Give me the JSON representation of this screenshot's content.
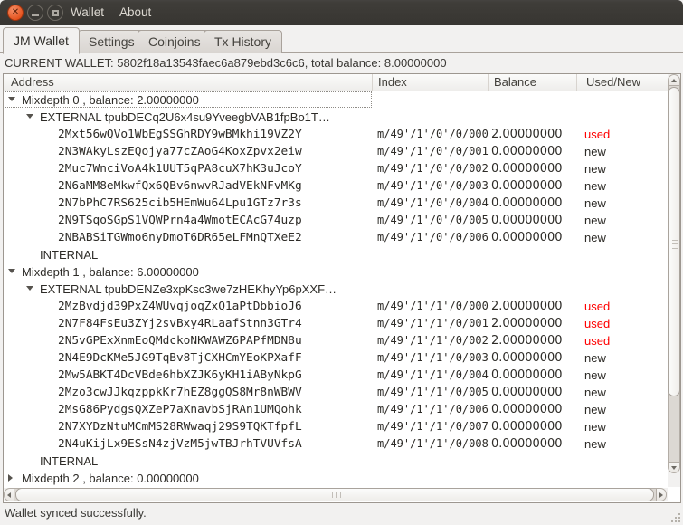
{
  "titlebar": {
    "menus": [
      "Wallet",
      "About"
    ]
  },
  "tabs": [
    {
      "label": "JM Wallet",
      "active": true
    },
    {
      "label": "Settings",
      "active": false
    },
    {
      "label": "Coinjoins",
      "active": false
    },
    {
      "label": "Tx History",
      "active": false
    }
  ],
  "wallet_summary": "CURRENT WALLET: 5802f18a13543faec6a879ebd3c6c6, total balance: 8.00000000",
  "tree": {
    "columns": [
      "Address",
      "Index",
      "Balance",
      "Used/New"
    ],
    "rows": [
      {
        "type": "group",
        "level": 0,
        "expanded": true,
        "focused": true,
        "label": "Mixdepth 0 , balance: 2.00000000"
      },
      {
        "type": "group",
        "level": 1,
        "expanded": true,
        "label": "EXTERNAL tpubDECq2U6x4su9YveegbVAB1fpBo1T…"
      },
      {
        "type": "address",
        "level": 2,
        "address": "2Mxt56wQVo1WbEgSSGhRDY9wBMkhi19VZ2Y",
        "index": "m/49'/1'/0'/0/000",
        "balance": "2.00000000",
        "status": "used"
      },
      {
        "type": "address",
        "level": 2,
        "address": "2N3WAkyLszEQojya77cZAoG4KoxZpvx2eiw",
        "index": "m/49'/1'/0'/0/001",
        "balance": "0.00000000",
        "status": "new"
      },
      {
        "type": "address",
        "level": 2,
        "address": "2Muc7WnciVoA4k1UUT5qPA8cuX7hK3uJcoY",
        "index": "m/49'/1'/0'/0/002",
        "balance": "0.00000000",
        "status": "new"
      },
      {
        "type": "address",
        "level": 2,
        "address": "2N6aMM8eMkwfQx6QBv6nwvRJadVEkNFvMKg",
        "index": "m/49'/1'/0'/0/003",
        "balance": "0.00000000",
        "status": "new"
      },
      {
        "type": "address",
        "level": 2,
        "address": "2N7bPhC7RS625cib5HEmWu64Lpu1GTz7r3s",
        "index": "m/49'/1'/0'/0/004",
        "balance": "0.00000000",
        "status": "new"
      },
      {
        "type": "address",
        "level": 2,
        "address": "2N9TSqoSGpS1VQWPrn4a4WmotECAcG74uzp",
        "index": "m/49'/1'/0'/0/005",
        "balance": "0.00000000",
        "status": "new"
      },
      {
        "type": "address",
        "level": 2,
        "address": "2NBABSiTGWmo6nyDmoT6DR65eLFMnQTXeE2",
        "index": "m/49'/1'/0'/0/006",
        "balance": "0.00000000",
        "status": "new"
      },
      {
        "type": "group",
        "level": 1,
        "label": "INTERNAL"
      },
      {
        "type": "group",
        "level": 0,
        "expanded": true,
        "label": "Mixdepth 1 , balance: 6.00000000"
      },
      {
        "type": "group",
        "level": 1,
        "expanded": true,
        "label": "EXTERNAL tpubDENZe3xpKsc3we7zHEKhyYp6pXXF…"
      },
      {
        "type": "address",
        "level": 2,
        "address": "2MzBvdjd39PxZ4WUvqjoqZxQ1aPtDbbioJ6",
        "index": "m/49'/1'/1'/0/000",
        "balance": "2.00000000",
        "status": "used"
      },
      {
        "type": "address",
        "level": 2,
        "address": "2N7F84FsEu3ZYj2svBxy4RLaafStnn3GTr4",
        "index": "m/49'/1'/1'/0/001",
        "balance": "2.00000000",
        "status": "used"
      },
      {
        "type": "address",
        "level": 2,
        "address": "2N5vGPExXnmEoQMdckoNKWAWZ6PAPfMDN8u",
        "index": "m/49'/1'/1'/0/002",
        "balance": "2.00000000",
        "status": "used"
      },
      {
        "type": "address",
        "level": 2,
        "address": "2N4E9DcKMe5JG9TqBv8TjCXHCmYEoKPXafF",
        "index": "m/49'/1'/1'/0/003",
        "balance": "0.00000000",
        "status": "new"
      },
      {
        "type": "address",
        "level": 2,
        "address": "2Mw5ABKT4DcVBde6hbXZJK6yKH1iAByNkpG",
        "index": "m/49'/1'/1'/0/004",
        "balance": "0.00000000",
        "status": "new"
      },
      {
        "type": "address",
        "level": 2,
        "address": "2Mzo3cwJJkqzppkKr7hEZ8ggQS8Mr8nWBWV",
        "index": "m/49'/1'/1'/0/005",
        "balance": "0.00000000",
        "status": "new"
      },
      {
        "type": "address",
        "level": 2,
        "address": "2MsG86PydgsQXZeP7aXnavbSjRAn1UMQohk",
        "index": "m/49'/1'/1'/0/006",
        "balance": "0.00000000",
        "status": "new"
      },
      {
        "type": "address",
        "level": 2,
        "address": "2N7XYDzNtuMCmMS28RWwaqj29S9TQKTfpfL",
        "index": "m/49'/1'/1'/0/007",
        "balance": "0.00000000",
        "status": "new"
      },
      {
        "type": "address",
        "level": 2,
        "address": "2N4uKijLx9ESsN4zjVzM5jwTBJrhTVUVfsA",
        "index": "m/49'/1'/1'/0/008",
        "balance": "0.00000000",
        "status": "new"
      },
      {
        "type": "group",
        "level": 1,
        "label": "INTERNAL"
      },
      {
        "type": "group",
        "level": 0,
        "expanded": false,
        "label": "Mixdepth 2 , balance: 0.00000000"
      }
    ]
  },
  "statusbar": {
    "message": "Wallet synced successfully."
  },
  "colors": {
    "used": "#ff0000",
    "new": "#2d2b27",
    "close_button": "#e4511c",
    "titlebar_bg": "#3b3935",
    "selection_focus": "#8e8b86"
  }
}
